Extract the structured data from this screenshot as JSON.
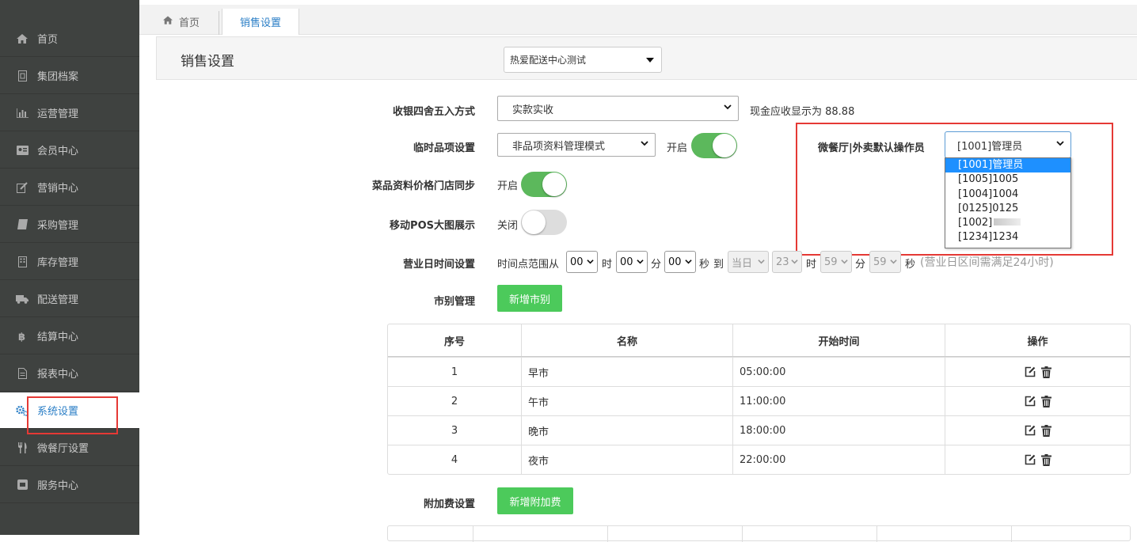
{
  "sidebar": {
    "items": [
      {
        "label": "首页",
        "icon": "home-icon"
      },
      {
        "label": "集团档案",
        "icon": "file-icon"
      },
      {
        "label": "运营管理",
        "icon": "bar-chart-icon"
      },
      {
        "label": "会员中心",
        "icon": "id-card-icon"
      },
      {
        "label": "营销中心",
        "icon": "edit-icon"
      },
      {
        "label": "采购管理",
        "icon": "book-icon"
      },
      {
        "label": "库存管理",
        "icon": "building-icon"
      },
      {
        "label": "配送管理",
        "icon": "truck-icon"
      },
      {
        "label": "结算中心",
        "icon": "bitcoin-icon"
      },
      {
        "label": "报表中心",
        "icon": "document-icon"
      },
      {
        "label": "系统设置",
        "icon": "gears-icon",
        "active": true
      },
      {
        "label": "微餐厅设置",
        "icon": "cutlery-icon"
      },
      {
        "label": "服务中心",
        "icon": "square-icon"
      }
    ]
  },
  "tabs": {
    "home_label": "首页",
    "current_label": "销售设置"
  },
  "header": {
    "title": "销售设置",
    "store_select_value": "热爱配送中心测试"
  },
  "form": {
    "rounding": {
      "label": "收银四舍五入方式",
      "value": "实款实收",
      "note": "现金应收显示为 88.88"
    },
    "temp_item": {
      "label": "临时品项设置",
      "value": "非品项资料管理模式",
      "switch_label": "开启",
      "switch_on": true
    },
    "price_sync": {
      "label": "菜品资料价格门店同步",
      "switch_label": "开启",
      "switch_on": true
    },
    "pos_image": {
      "label": "移动POS大图展示",
      "switch_label": "关闭",
      "switch_on": false
    },
    "business_time": {
      "label": "营业日时间设置",
      "range_label": "时间点范围从",
      "start_hour": "00",
      "hour_unit": "时",
      "start_min": "00",
      "min_unit": "分",
      "start_sec": "00",
      "sec_unit": "秒",
      "to_label": "到",
      "end_day": "当日",
      "end_hour": "23",
      "end_min": "59",
      "end_sec": "59",
      "hint": "(营业日区间需满足24小时)"
    },
    "market": {
      "label": "市别管理",
      "add_button": "新增市别"
    },
    "surcharge": {
      "label": "附加费设置",
      "add_button": "新增附加费"
    },
    "operator": {
      "label": "微餐厅|外卖默认操作员",
      "value": "[1001]管理员",
      "options": [
        "[1001]管理员",
        "[1005]1005",
        "[1004]1004",
        "[0125]0125",
        "[1002]",
        "[1234]1234"
      ]
    }
  },
  "market_table": {
    "headers": [
      "序号",
      "名称",
      "开始时间",
      "操作"
    ],
    "rows": [
      {
        "no": "1",
        "name": "早市",
        "start": "05:00:00"
      },
      {
        "no": "2",
        "name": "午市",
        "start": "11:00:00"
      },
      {
        "no": "3",
        "name": "晚市",
        "start": "18:00:00"
      },
      {
        "no": "4",
        "name": "夜市",
        "start": "22:00:00"
      }
    ]
  },
  "colors": {
    "sidebar_bg": "#3f4240",
    "accent_blue": "#2a7ec6",
    "green": "#4cca5b",
    "switch_green": "#5cb85c",
    "highlight_red": "#e53935"
  }
}
